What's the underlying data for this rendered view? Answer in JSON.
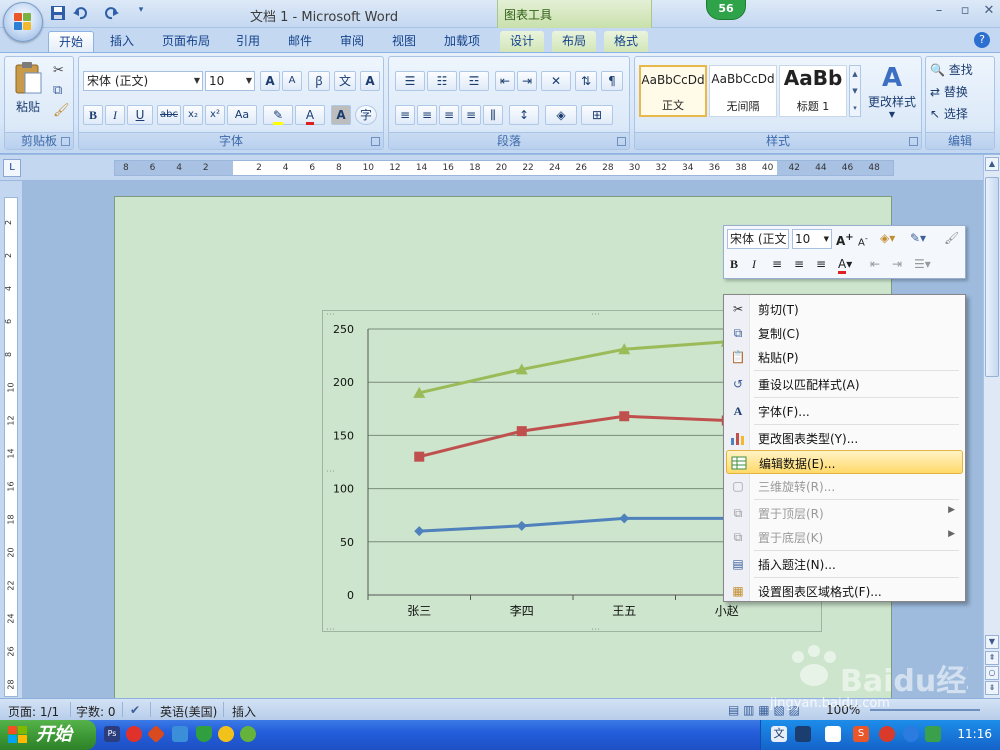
{
  "titlebar": {
    "title": "文档 1 - Microsoft Word",
    "context_group": "图表工具",
    "badge": "56"
  },
  "tabs": [
    {
      "label": "开始",
      "active": true
    },
    {
      "label": "插入"
    },
    {
      "label": "页面布局"
    },
    {
      "label": "引用"
    },
    {
      "label": "邮件"
    },
    {
      "label": "审阅"
    },
    {
      "label": "视图"
    },
    {
      "label": "加载项"
    },
    {
      "label": "设计",
      "contextual": true
    },
    {
      "label": "布局",
      "contextual": true
    },
    {
      "label": "格式",
      "contextual": true
    }
  ],
  "ribbon": {
    "clipboard": {
      "label": "剪贴板",
      "paste_label": "粘贴"
    },
    "font": {
      "label": "字体",
      "font_name": "宋体 (正文)",
      "font_size": "10"
    },
    "paragraph": {
      "label": "段落"
    },
    "styles": {
      "label": "样式",
      "items": [
        {
          "sample": "AaBbCcDd",
          "name": "正文"
        },
        {
          "sample": "AaBbCcDd",
          "name": "无间隔"
        },
        {
          "sample": "AaBb",
          "name": "标题 1"
        }
      ],
      "change_styles": "更改样式"
    },
    "editing": {
      "label": "编辑",
      "find": "查找",
      "replace": "替换",
      "select": "选择"
    }
  },
  "ruler": {
    "labels": [
      "8",
      "6",
      "4",
      "2",
      "",
      "2",
      "4",
      "6",
      "8",
      "10",
      "12",
      "14",
      "16",
      "18",
      "20",
      "22",
      "24",
      "26",
      "28",
      "30",
      "32",
      "34",
      "36",
      "38",
      "40",
      "42",
      "44",
      "46",
      "48"
    ]
  },
  "vruler": {
    "labels": [
      "2",
      "2",
      "4",
      "6",
      "8",
      "10",
      "12",
      "14",
      "16",
      "18",
      "20",
      "22",
      "24",
      "26",
      "28"
    ]
  },
  "chart_data": {
    "type": "line",
    "categories": [
      "张三",
      "李四",
      "王五",
      "小赵"
    ],
    "series": [
      {
        "values": [
          190,
          212,
          231,
          238
        ],
        "color": "#9bbb59",
        "marker": "triangle"
      },
      {
        "values": [
          130,
          154,
          168,
          164
        ],
        "color": "#c0504d",
        "marker": "square"
      },
      {
        "values": [
          60,
          65,
          72,
          72
        ],
        "color": "#4f81bd",
        "marker": "diamond"
      }
    ],
    "ylim": [
      0,
      250
    ],
    "yticks": [
      0,
      50,
      100,
      150,
      200,
      250
    ],
    "ytick_labels": [
      "0",
      "50",
      "100",
      "150",
      "200",
      "250"
    ],
    "grid": true,
    "legend": "right (partially covered)"
  },
  "minibar": {
    "font_name": "宋体 (正文",
    "font_size": "10"
  },
  "context_menu": {
    "items": [
      {
        "label": "剪切(T)",
        "icon": "scissors-icon"
      },
      {
        "label": "复制(C)",
        "icon": "copy-icon"
      },
      {
        "label": "粘贴(P)",
        "icon": "paste-icon"
      },
      {
        "label": "重设以匹配样式(A)",
        "icon": "reset-style-icon"
      },
      {
        "label": "字体(F)...",
        "icon": "font-icon"
      },
      {
        "label": "更改图表类型(Y)...",
        "icon": "chart-type-icon"
      },
      {
        "label": "编辑数据(E)...",
        "icon": "edit-data-icon",
        "highlighted": true
      },
      {
        "label": "三维旋转(R)...",
        "icon": "3d-rotate-icon",
        "disabled": true
      },
      {
        "label": "置于顶层(R)",
        "icon": "bring-front-icon",
        "disabled": true,
        "submenu": true
      },
      {
        "label": "置于底层(K)",
        "icon": "send-back-icon",
        "disabled": true,
        "submenu": true
      },
      {
        "label": "插入题注(N)...",
        "icon": "caption-icon"
      },
      {
        "label": "设置图表区域格式(F)...",
        "icon": "format-chart-area-icon"
      }
    ]
  },
  "statusbar": {
    "page": "页面: 1/1",
    "words": "字数: 0",
    "language": "英语(美国)",
    "mode": "插入",
    "zoom": "100%"
  },
  "taskbar": {
    "start": "开始",
    "clock": "11:16",
    "tray_label": "文"
  },
  "watermark": {
    "brand": "Baidu经验",
    "url": "jingyan.baidu.com"
  }
}
